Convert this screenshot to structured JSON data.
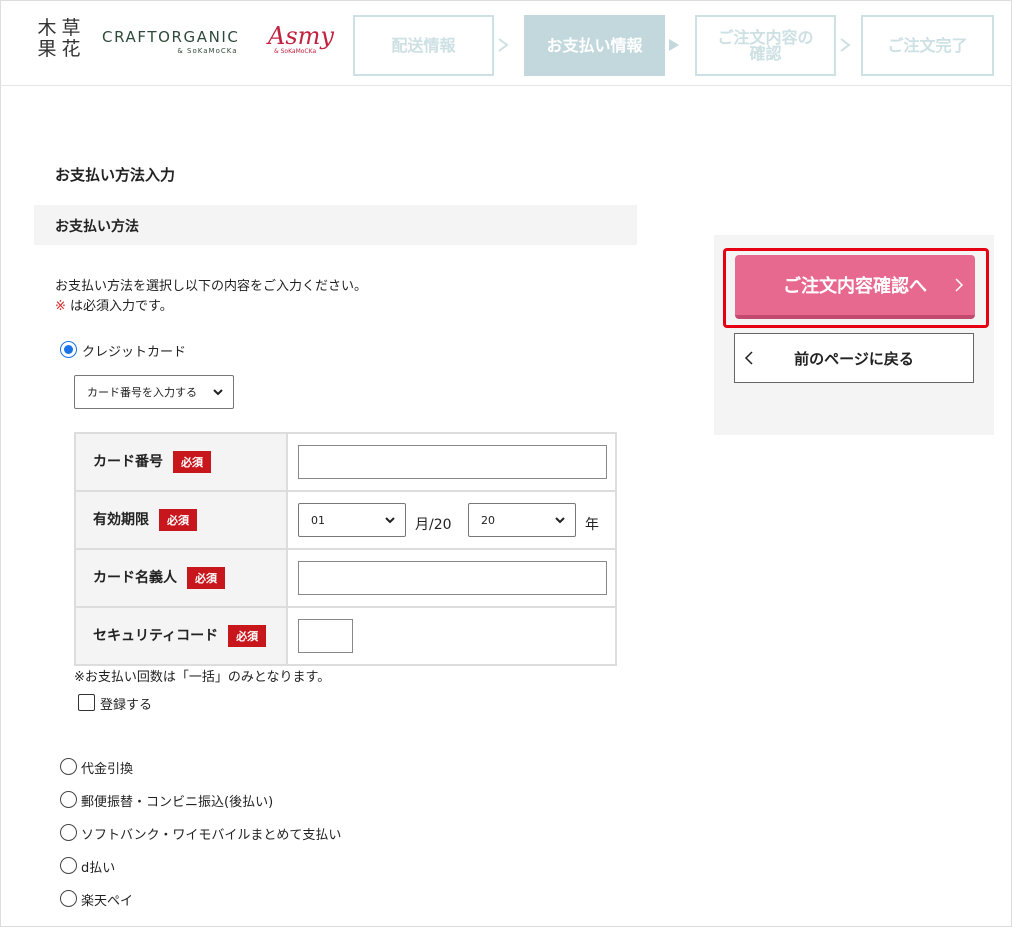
{
  "header": {
    "logo_kusaka": [
      "木",
      "草",
      "果",
      "花"
    ],
    "logo_craft_main": "CRAFTORGANIC",
    "logo_craft_sub": "& SoKaMoCKa",
    "logo_asmy_main": "Asmy",
    "logo_asmy_sub": "& SoKaMoCKa",
    "steps": [
      {
        "label": "配送情報",
        "active": false
      },
      {
        "label": "お支払い情報",
        "active": true
      },
      {
        "label_line1": "ご注文内容の",
        "label_line2": "確認",
        "active": false
      },
      {
        "label": "ご注文完了",
        "active": false
      }
    ]
  },
  "main": {
    "section_title": "お支払い方法入力",
    "method_bar_title": "お支払い方法",
    "instruction_line1": "お支払い方法を選択し以下の内容をご入力ください。",
    "required_mark": "※",
    "instruction_line2": " は必須入力です。",
    "credit_label": "クレジットカード",
    "card_select_value": "カード番号を入力する",
    "fields": {
      "card_number": "カード番号",
      "expiry": "有効期限",
      "card_name": "カード名義人",
      "security_code": "セキュリティコード",
      "required_badge": "必須"
    },
    "expiry_month_value": "01",
    "expiry_month_suffix": "月/20",
    "expiry_year_value": "20",
    "expiry_year_suffix": "年",
    "installment_note": "※お支払い回数は「一括」のみとなります。",
    "register_label": "登録する",
    "other_methods": [
      "代金引換",
      "郵便振替・コンビニ振込(後払い)",
      "ソフトバンク・ワイモバイルまとめて支払い",
      "d払い",
      "楽天ペイ"
    ]
  },
  "sidebar": {
    "confirm_button": "ご注文内容確認へ",
    "back_button": "前のページに戻る"
  },
  "colors": {
    "accent_pink": "#e8698f",
    "step_active": "#c2d8dc",
    "required_red": "#c8161d",
    "highlight_red": "#e60012"
  }
}
